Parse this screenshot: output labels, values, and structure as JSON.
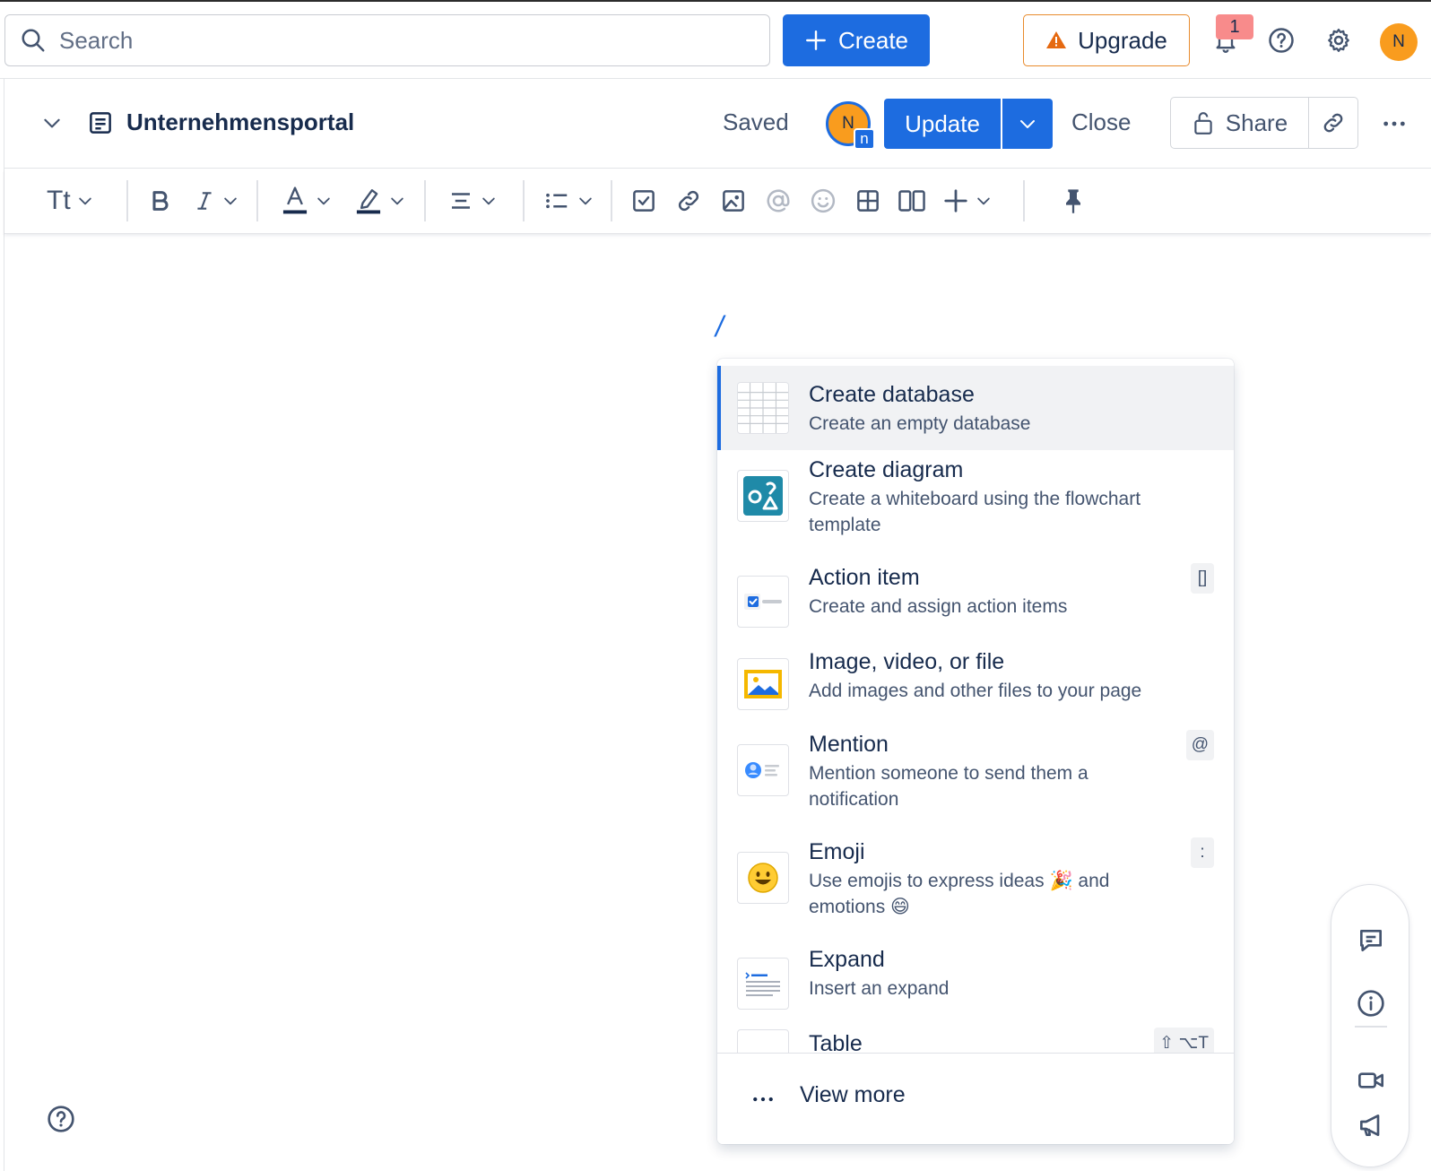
{
  "topbar": {
    "search_placeholder": "Search",
    "create_label": "Create",
    "upgrade_label": "Upgrade",
    "notification_count": "1",
    "user_initial": "N",
    "icons": [
      "search-icon",
      "plus-icon",
      "warning-icon",
      "bell-icon",
      "help-icon",
      "gear-icon"
    ]
  },
  "page": {
    "title": "Unternehmensportal",
    "status": "Saved",
    "editor_initial": "N",
    "editor_badge": "n",
    "update_label": "Update",
    "close_label": "Close",
    "share_label": "Share"
  },
  "toolbar": {
    "text_style_label": "Tt",
    "items": [
      "text-style",
      "bold",
      "italic",
      "text-color",
      "highlight",
      "align",
      "list",
      "action-item",
      "link",
      "image",
      "mention",
      "emoji",
      "table",
      "layouts",
      "insert",
      "pin"
    ]
  },
  "editor": {
    "typed": "/"
  },
  "slash_menu": {
    "items": [
      {
        "title": "Create database",
        "description": "Create an empty database",
        "shortcut": ""
      },
      {
        "title": "Create diagram",
        "description": "Create a whiteboard using the flowchart template",
        "shortcut": ""
      },
      {
        "title": "Action item",
        "description": "Create and assign action items",
        "shortcut": "[]"
      },
      {
        "title": "Image, video, or file",
        "description": "Add images and other files to your page",
        "shortcut": ""
      },
      {
        "title": "Mention",
        "description": "Mention someone to send them a notification",
        "shortcut": "@"
      },
      {
        "title": "Emoji",
        "description": "Use emojis to express ideas 🎉 and emotions 😄",
        "shortcut": ":"
      },
      {
        "title": "Expand",
        "description": "Insert an expand",
        "shortcut": ""
      },
      {
        "title": "Table",
        "description": "",
        "shortcut": "⇧ ⌥T"
      }
    ],
    "view_more_label": "View more"
  },
  "colors": {
    "primary": "#1d6ce0",
    "upgrade_border": "#e88b2d",
    "warning": "#e56910",
    "avatar": "#f99c1e",
    "badge": "#f88b8b"
  }
}
